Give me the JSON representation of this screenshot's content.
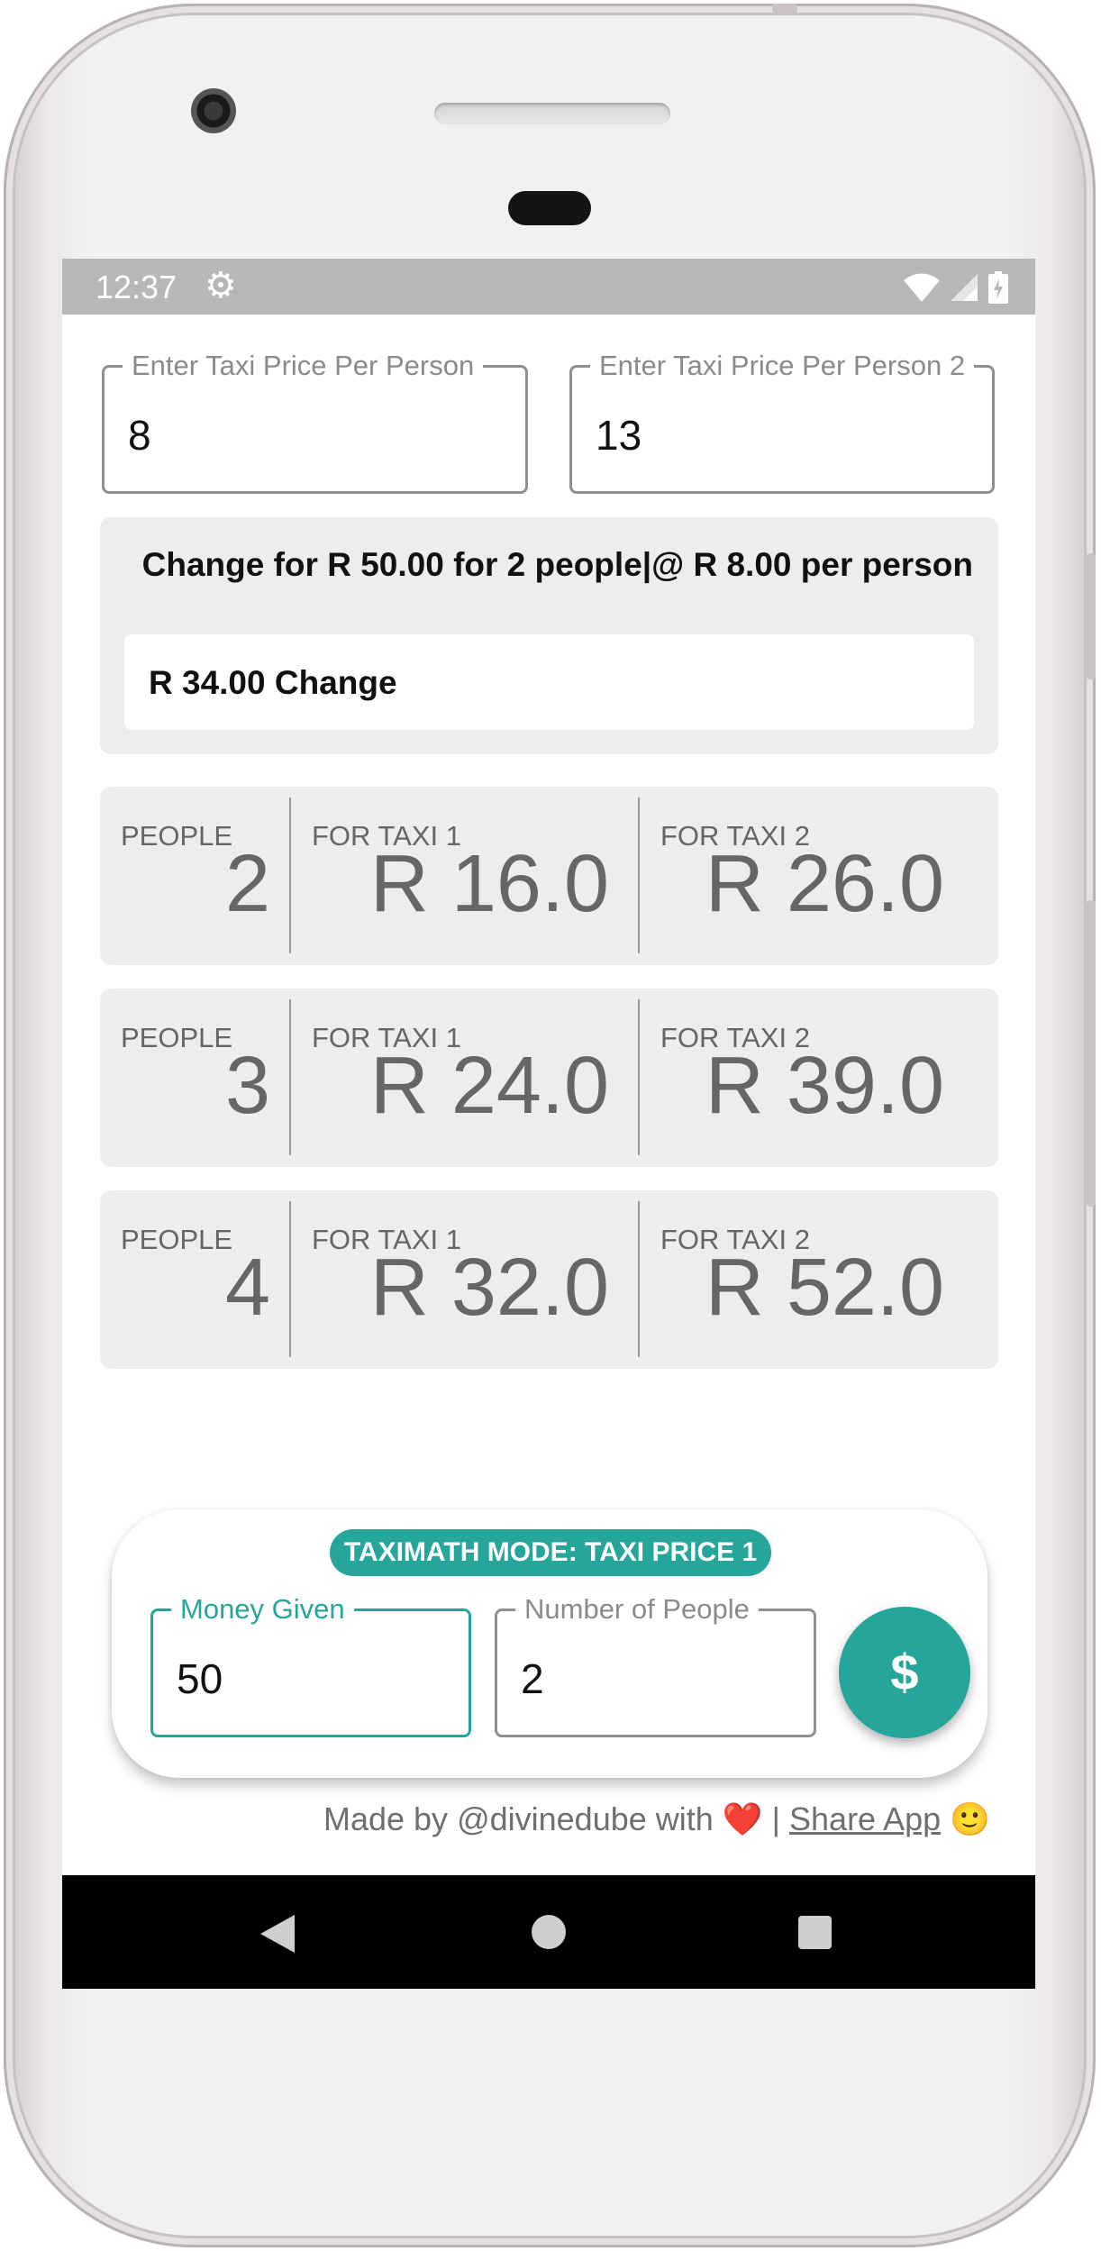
{
  "status_bar": {
    "time": "12:37",
    "icons": [
      "gear-icon",
      "wifi-icon",
      "signal-icon",
      "battery-icon"
    ]
  },
  "inputs": {
    "price1": {
      "label": "Enter Taxi Price Per Person",
      "value": "8"
    },
    "price2": {
      "label": "Enter Taxi Price Per Person 2",
      "value": "13"
    }
  },
  "change": {
    "summary": "Change for R 50.00 for 2 people|@ R 8.00 per person",
    "value": "R 34.00 Change"
  },
  "calc_rows": [
    {
      "people_label": "PEOPLE",
      "people": "2",
      "taxi1_label": "FOR TAXI 1",
      "taxi1_price": "R 16.0",
      "taxi2_label": "FOR TAXI 2",
      "taxi2_price": "R 26.0"
    },
    {
      "people_label": "PEOPLE",
      "people": "3",
      "taxi1_label": "FOR TAXI 1",
      "taxi1_price": "R 24.0",
      "taxi2_label": "FOR TAXI 2",
      "taxi2_price": "R 39.0"
    },
    {
      "people_label": "PEOPLE",
      "people": "4",
      "taxi1_label": "FOR TAXI 1",
      "taxi1_price": "R 32.0",
      "taxi2_label": "FOR TAXI 2",
      "taxi2_price": "R 52.0"
    }
  ],
  "bottom_panel": {
    "mode": "TAXIMATH MODE: TAXI PRICE 1",
    "money_given": {
      "label": "Money Given",
      "value": "50"
    },
    "num_people": {
      "label": "Number of People",
      "value": "2"
    },
    "fab_symbol": "$"
  },
  "credits": {
    "text": "Made by @divinedube with",
    "heart": "❤️",
    "separator": "|",
    "share": "Share App",
    "smiley": "🙂"
  },
  "colors": {
    "accent": "#26a69a",
    "card_bg": "#ededed",
    "status_bar": "#b7b7b7",
    "nav_bar": "#000000"
  }
}
